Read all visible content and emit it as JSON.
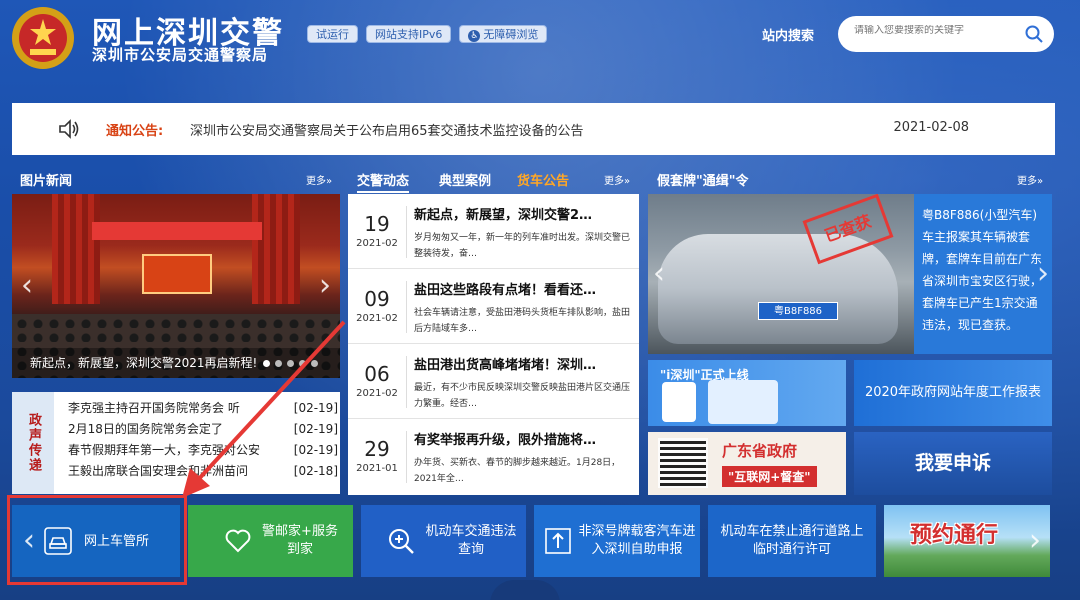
{
  "header": {
    "site_title": "网上深圳交警",
    "site_subtitle": "深圳市公安局交通警察局",
    "badges": [
      "试运行",
      "网站支持IPv6",
      "无障碍浏览"
    ],
    "search_label": "站内搜索",
    "search_placeholder": "请输入您要搜索的关键字"
  },
  "notice": {
    "label": "通知公告:",
    "text": "深圳市公安局交通警察局关于公布启用65套交通技术监控设备的公告",
    "date": "2021-02-08"
  },
  "photo_news": {
    "title": "图片新闻",
    "more": "更多»",
    "caption": "新起点，新展望，深圳交警2021再启新程!"
  },
  "policy": {
    "side_label": "政声传递",
    "items": [
      {
        "title": "李克强主持召开国务院常务会 听",
        "date": "[02-19]"
      },
      {
        "title": "2月18日的国务院常务会定了",
        "date": "[02-19]"
      },
      {
        "title": "春节假期拜年第一大，李克强对公安",
        "date": "[02-19]"
      },
      {
        "title": "王毅出席联合国安理会和非洲苗问",
        "date": "[02-18]"
      }
    ]
  },
  "tabs": {
    "items": [
      "交警动态",
      "典型案例",
      "货车公告"
    ],
    "more": "更多»"
  },
  "traffic_news": [
    {
      "day": "19",
      "ym": "2021-02",
      "title": "新起点，新展望，深圳交警2…",
      "desc": "岁月匆匆又一年，新一年的列车准时出发。深圳交警已整装待发，奋…"
    },
    {
      "day": "09",
      "ym": "2021-02",
      "title": "盐田这些路段有点堵！看看还…",
      "desc": "社会车辆请注意，受盐田港码头货柜车排队影响，盐田后方陆域车多…"
    },
    {
      "day": "06",
      "ym": "2021-02",
      "title": "盐田港出货高峰堵堵堵！深圳…",
      "desc": "最近，有不少市民反映深圳交警反映盐田港片区交通压力繁重。经否…"
    },
    {
      "day": "29",
      "ym": "2021-01",
      "title": "有奖举报再升级，限外措施将…",
      "desc": "办年货、买新衣、春节的脚步越来越近。1月28日，2021年全…"
    }
  ],
  "fake_plate": {
    "title": "假套牌\"通缉\"令",
    "more": "更多»",
    "stamp": "已查获",
    "plate": "粤B8F886",
    "info": "粤B8F886(小型汽车)车主报案其车辆被套牌，套牌车目前在广东省深圳市宝安区行驶，套牌车已产生1宗交通违法，现已查获。"
  },
  "promos": {
    "isz": "\"i深圳\"正式上线",
    "gov_report": "2020年政府网站年度工作报表",
    "gd_title": "广东省政府",
    "gd_sub": "\"互联网+督查\"",
    "apply": "我要申诉"
  },
  "services": [
    {
      "label": "网上车管所"
    },
    {
      "label": "警邮家+服务到家"
    },
    {
      "label": "机动车交通违法查询"
    },
    {
      "label": "非深号牌载客汽车进入深圳自助申报"
    },
    {
      "label": "机动车在禁止通行道路上临时通行许可"
    },
    {
      "label": "预约通行"
    }
  ]
}
